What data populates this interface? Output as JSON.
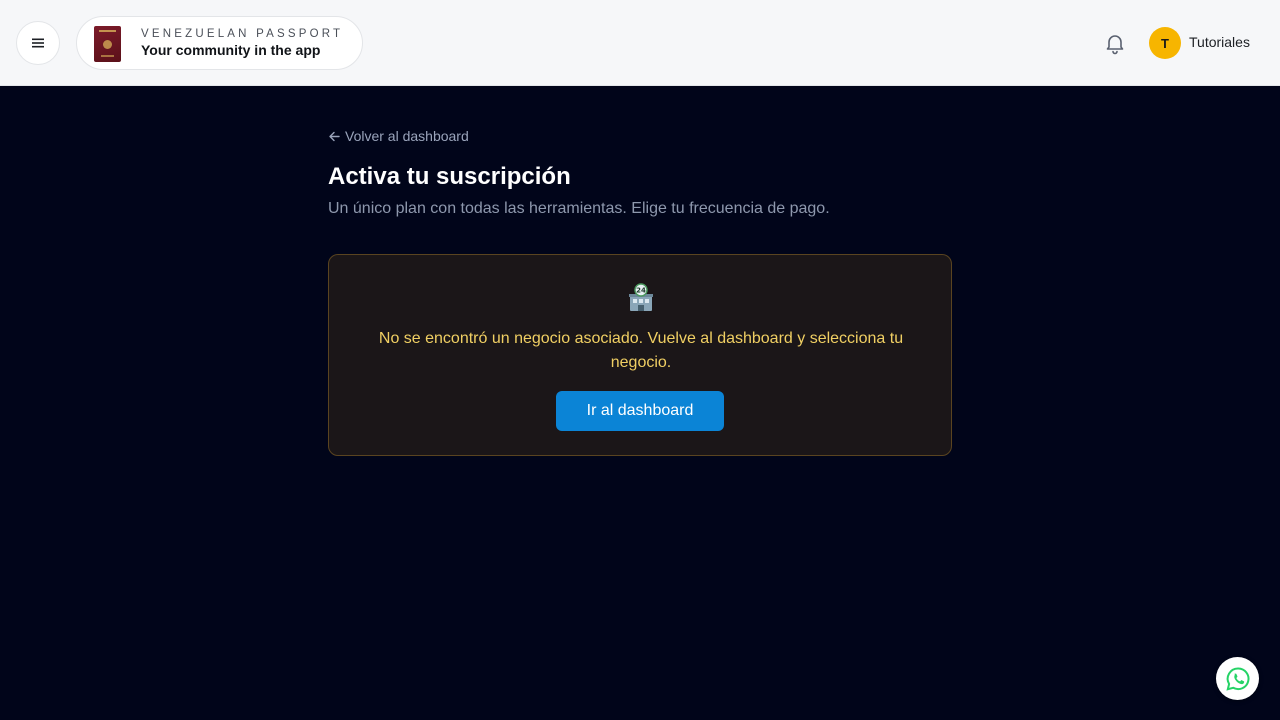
{
  "header": {
    "menu_icon": "hamburger-icon",
    "brand_top": "VENEZUELAN PASSPORT",
    "brand_bottom": "Your community in the app",
    "notification_icon": "bell-icon",
    "avatar_initial": "T",
    "username": "Tutoriales"
  },
  "main": {
    "back_link": "Volver al dashboard",
    "back_icon": "arrow-left-icon",
    "title": "Activa tu suscripción",
    "subtitle": "Un único plan con todas las herramientas. Elige tu frecuencia de pago.",
    "alert": {
      "icon": "business-24h-icon",
      "message": "No se encontró un negocio asociado. Vuelve al dashboard y selecciona tu negocio.",
      "button_label": "Ir al dashboard"
    }
  },
  "floating": {
    "whatsapp_icon": "whatsapp-icon"
  },
  "colors": {
    "background": "#01051a",
    "header": "#f6f7f9",
    "accent": "#0b84d6",
    "warning_text": "#f0cf63",
    "avatar": "#f7b500",
    "whatsapp": "#25d366"
  }
}
